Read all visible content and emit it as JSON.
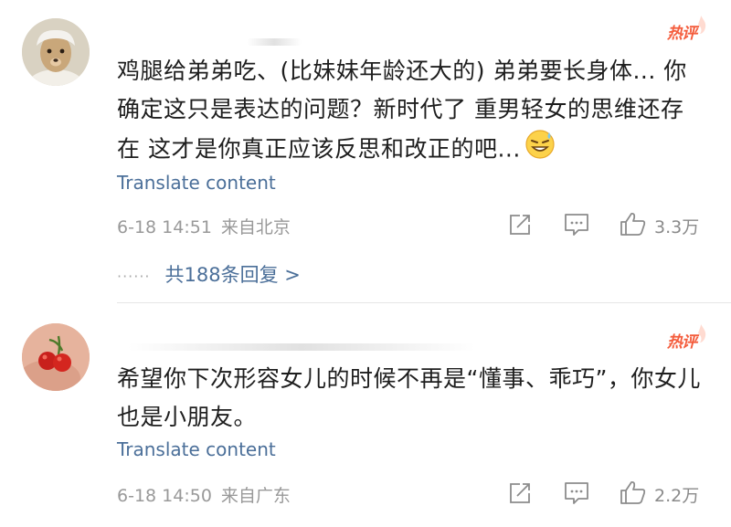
{
  "comments": [
    {
      "badge": "热评",
      "text": "鸡腿给弟弟吃、(比妹妹年龄还大的) 弟弟要长身体... 你确定这只是表达的问题？新时代了 重男轻女的思维还存在 这才是你真正应该反思和改正的吧...",
      "emoji": "grinning-sweat-emoji",
      "translate": "Translate content",
      "time": "6-18 14:51",
      "location": "来自北京",
      "likes": "3.3万",
      "replies": "共188条回复 >"
    },
    {
      "badge": "热评",
      "text": "希望你下次形容女儿的时候不再是“懂事、乖巧”，你女儿也是小朋友。",
      "translate": "Translate content",
      "time": "6-18 14:50",
      "location": "来自广东",
      "likes": "2.2万"
    }
  ],
  "colors": {
    "link": "#4b6f99",
    "hot": "#f45c3c",
    "meta": "#999999"
  },
  "icons": {
    "repost": "share-square-icon",
    "comment": "comment-icon",
    "like": "thumbs-up-icon"
  }
}
